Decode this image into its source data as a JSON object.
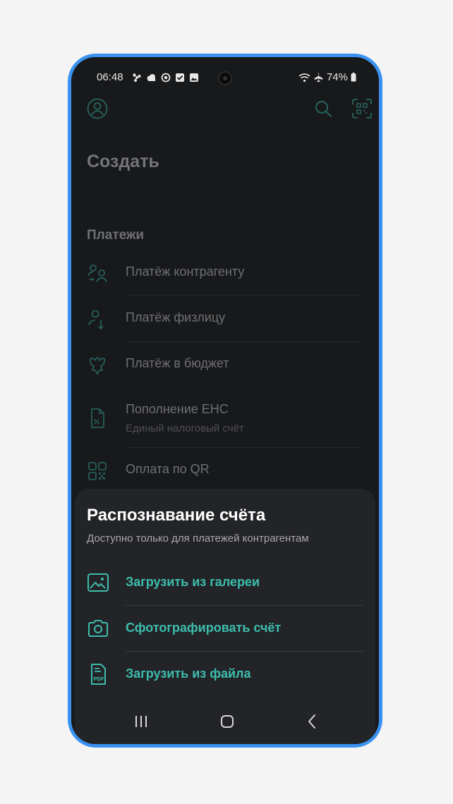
{
  "status_bar": {
    "time": "06:48",
    "battery": "74%",
    "notification_icons": [
      "fan-icon",
      "cloud-icon",
      "record-icon",
      "checkbox-icon",
      "image-icon"
    ],
    "system_icons": [
      "wifi-icon",
      "airplane-icon",
      "battery-icon"
    ]
  },
  "header": {
    "profile_icon": "profile-icon",
    "search_icon": "search-icon",
    "qr_scan_icon": "qr-scan-icon"
  },
  "page": {
    "title": "Создать",
    "section_title": "Платежи",
    "items": [
      {
        "label": "Платёж контрагенту",
        "icon": "counterparty-icon"
      },
      {
        "label": "Платёж физлицу",
        "icon": "person-payment-icon"
      },
      {
        "label": "Платёж в бюджет",
        "icon": "budget-emblem-icon"
      },
      {
        "label": "Пополнение ЕНС",
        "sub": "Единый налоговый счёт",
        "icon": "tax-document-icon"
      },
      {
        "label": "Оплата по QR",
        "icon": "qr-code-icon"
      }
    ]
  },
  "sheet": {
    "title": "Распознавание счёта",
    "subtitle": "Доступно только для платежей контрагентам",
    "actions": [
      {
        "label": "Загрузить из галереи",
        "icon": "gallery-icon"
      },
      {
        "label": "Сфотографировать счёт",
        "icon": "camera-icon"
      },
      {
        "label": "Загрузить из файла",
        "icon": "pdf-file-icon"
      }
    ]
  },
  "nav_bar": {
    "buttons": [
      "recent-apps-icon",
      "home-icon",
      "back-icon"
    ]
  },
  "colors": {
    "accent": "#3dbdae",
    "frame": "#3a92f0",
    "background": "#18191b",
    "sheet": "#232427"
  }
}
